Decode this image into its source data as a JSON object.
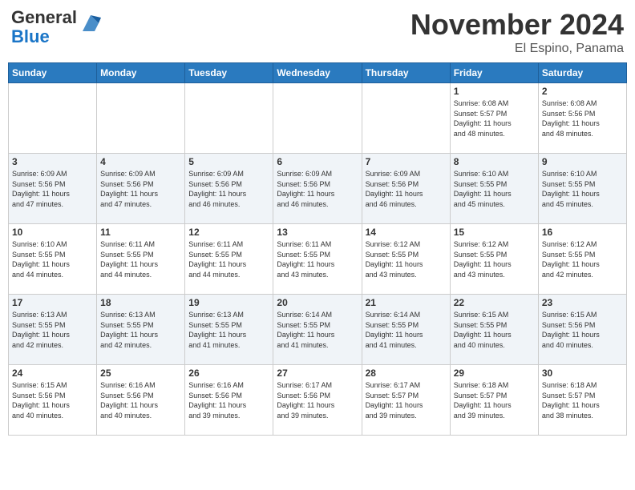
{
  "header": {
    "logo_line1": "General",
    "logo_line2": "Blue",
    "month": "November 2024",
    "location": "El Espino, Panama"
  },
  "days_of_week": [
    "Sunday",
    "Monday",
    "Tuesday",
    "Wednesday",
    "Thursday",
    "Friday",
    "Saturday"
  ],
  "weeks": [
    [
      {
        "day": "",
        "info": ""
      },
      {
        "day": "",
        "info": ""
      },
      {
        "day": "",
        "info": ""
      },
      {
        "day": "",
        "info": ""
      },
      {
        "day": "",
        "info": ""
      },
      {
        "day": "1",
        "info": "Sunrise: 6:08 AM\nSunset: 5:57 PM\nDaylight: 11 hours\nand 48 minutes."
      },
      {
        "day": "2",
        "info": "Sunrise: 6:08 AM\nSunset: 5:56 PM\nDaylight: 11 hours\nand 48 minutes."
      }
    ],
    [
      {
        "day": "3",
        "info": "Sunrise: 6:09 AM\nSunset: 5:56 PM\nDaylight: 11 hours\nand 47 minutes."
      },
      {
        "day": "4",
        "info": "Sunrise: 6:09 AM\nSunset: 5:56 PM\nDaylight: 11 hours\nand 47 minutes."
      },
      {
        "day": "5",
        "info": "Sunrise: 6:09 AM\nSunset: 5:56 PM\nDaylight: 11 hours\nand 46 minutes."
      },
      {
        "day": "6",
        "info": "Sunrise: 6:09 AM\nSunset: 5:56 PM\nDaylight: 11 hours\nand 46 minutes."
      },
      {
        "day": "7",
        "info": "Sunrise: 6:09 AM\nSunset: 5:56 PM\nDaylight: 11 hours\nand 46 minutes."
      },
      {
        "day": "8",
        "info": "Sunrise: 6:10 AM\nSunset: 5:55 PM\nDaylight: 11 hours\nand 45 minutes."
      },
      {
        "day": "9",
        "info": "Sunrise: 6:10 AM\nSunset: 5:55 PM\nDaylight: 11 hours\nand 45 minutes."
      }
    ],
    [
      {
        "day": "10",
        "info": "Sunrise: 6:10 AM\nSunset: 5:55 PM\nDaylight: 11 hours\nand 44 minutes."
      },
      {
        "day": "11",
        "info": "Sunrise: 6:11 AM\nSunset: 5:55 PM\nDaylight: 11 hours\nand 44 minutes."
      },
      {
        "day": "12",
        "info": "Sunrise: 6:11 AM\nSunset: 5:55 PM\nDaylight: 11 hours\nand 44 minutes."
      },
      {
        "day": "13",
        "info": "Sunrise: 6:11 AM\nSunset: 5:55 PM\nDaylight: 11 hours\nand 43 minutes."
      },
      {
        "day": "14",
        "info": "Sunrise: 6:12 AM\nSunset: 5:55 PM\nDaylight: 11 hours\nand 43 minutes."
      },
      {
        "day": "15",
        "info": "Sunrise: 6:12 AM\nSunset: 5:55 PM\nDaylight: 11 hours\nand 43 minutes."
      },
      {
        "day": "16",
        "info": "Sunrise: 6:12 AM\nSunset: 5:55 PM\nDaylight: 11 hours\nand 42 minutes."
      }
    ],
    [
      {
        "day": "17",
        "info": "Sunrise: 6:13 AM\nSunset: 5:55 PM\nDaylight: 11 hours\nand 42 minutes."
      },
      {
        "day": "18",
        "info": "Sunrise: 6:13 AM\nSunset: 5:55 PM\nDaylight: 11 hours\nand 42 minutes."
      },
      {
        "day": "19",
        "info": "Sunrise: 6:13 AM\nSunset: 5:55 PM\nDaylight: 11 hours\nand 41 minutes."
      },
      {
        "day": "20",
        "info": "Sunrise: 6:14 AM\nSunset: 5:55 PM\nDaylight: 11 hours\nand 41 minutes."
      },
      {
        "day": "21",
        "info": "Sunrise: 6:14 AM\nSunset: 5:55 PM\nDaylight: 11 hours\nand 41 minutes."
      },
      {
        "day": "22",
        "info": "Sunrise: 6:15 AM\nSunset: 5:55 PM\nDaylight: 11 hours\nand 40 minutes."
      },
      {
        "day": "23",
        "info": "Sunrise: 6:15 AM\nSunset: 5:56 PM\nDaylight: 11 hours\nand 40 minutes."
      }
    ],
    [
      {
        "day": "24",
        "info": "Sunrise: 6:15 AM\nSunset: 5:56 PM\nDaylight: 11 hours\nand 40 minutes."
      },
      {
        "day": "25",
        "info": "Sunrise: 6:16 AM\nSunset: 5:56 PM\nDaylight: 11 hours\nand 40 minutes."
      },
      {
        "day": "26",
        "info": "Sunrise: 6:16 AM\nSunset: 5:56 PM\nDaylight: 11 hours\nand 39 minutes."
      },
      {
        "day": "27",
        "info": "Sunrise: 6:17 AM\nSunset: 5:56 PM\nDaylight: 11 hours\nand 39 minutes."
      },
      {
        "day": "28",
        "info": "Sunrise: 6:17 AM\nSunset: 5:57 PM\nDaylight: 11 hours\nand 39 minutes."
      },
      {
        "day": "29",
        "info": "Sunrise: 6:18 AM\nSunset: 5:57 PM\nDaylight: 11 hours\nand 39 minutes."
      },
      {
        "day": "30",
        "info": "Sunrise: 6:18 AM\nSunset: 5:57 PM\nDaylight: 11 hours\nand 38 minutes."
      }
    ]
  ]
}
